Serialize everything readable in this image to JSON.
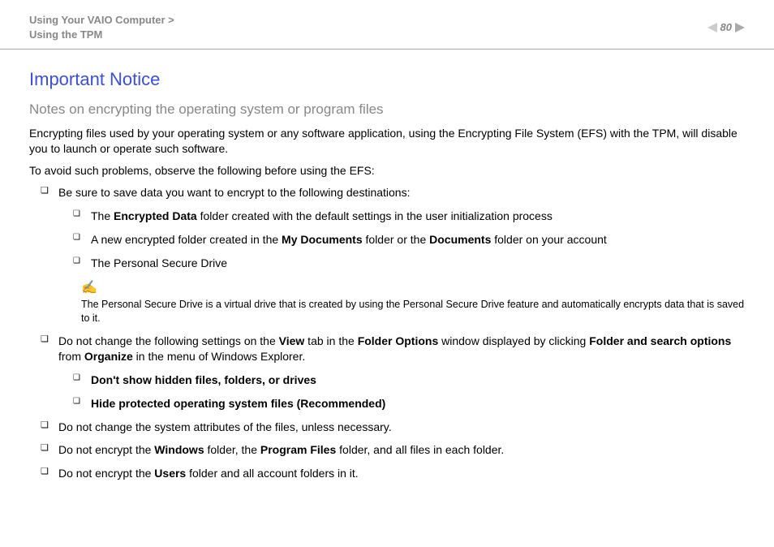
{
  "header": {
    "breadcrumb_line1": "Using Your VAIO Computer >",
    "breadcrumb_line2": "Using the TPM",
    "page_number": "80"
  },
  "title": "Important Notice",
  "subtitle": "Notes on encrypting the operating system or program files",
  "para1": "Encrypting files used by your operating system or any software application, using the Encrypting File System (EFS) with the TPM, will disable you to launch or operate such software.",
  "para2": "To avoid such problems, observe the following before using the EFS:",
  "bullet1": "Be sure to save data you want to encrypt to the following destinations:",
  "sub1a_pre": "The ",
  "sub1a_bold": "Encrypted Data",
  "sub1a_post": " folder created with the default settings in the user initialization process",
  "sub1b_pre": "A new encrypted folder created in the ",
  "sub1b_bold1": "My Documents",
  "sub1b_mid": " folder or the ",
  "sub1b_bold2": "Documents",
  "sub1b_post": " folder on your account",
  "sub1c": "The Personal Secure Drive",
  "note_icon": "✍",
  "note_text": "The Personal Secure Drive is a virtual drive that is created by using the Personal Secure Drive feature and automatically encrypts data that is saved to it.",
  "bullet2_pre": "Do not change the following settings on the ",
  "bullet2_b1": "View",
  "bullet2_m1": " tab in the ",
  "bullet2_b2": "Folder Options",
  "bullet2_m2": " window displayed by clicking ",
  "bullet2_b3": "Folder and search options",
  "bullet2_m3": " from ",
  "bullet2_b4": "Organize",
  "bullet2_post": " in the menu of Windows Explorer.",
  "sub2a": "Don't show hidden files, folders, or drives",
  "sub2b": "Hide protected operating system files (Recommended)",
  "bullet3": "Do not change the system attributes of the files, unless necessary.",
  "bullet4_pre": "Do not encrypt the ",
  "bullet4_b1": "Windows",
  "bullet4_m1": " folder, the ",
  "bullet4_b2": "Program Files",
  "bullet4_post": " folder, and all files in each folder.",
  "bullet5_pre": "Do not encrypt the ",
  "bullet5_b1": "Users",
  "bullet5_post": " folder and all account folders in it."
}
